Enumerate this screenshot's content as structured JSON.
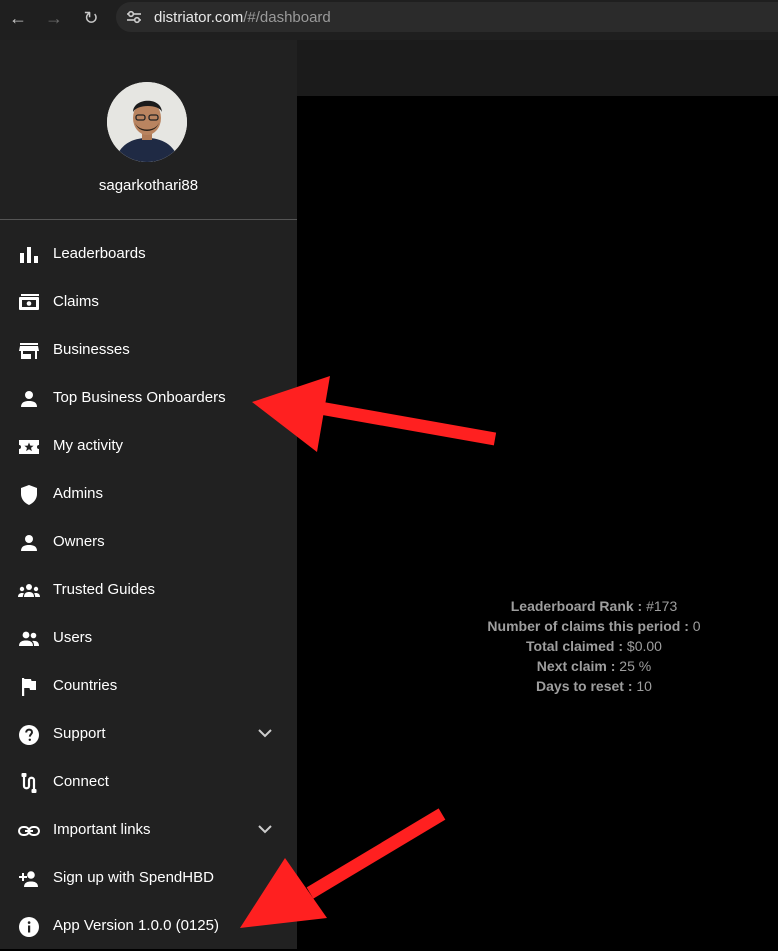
{
  "browser": {
    "url_host": "distriator.com",
    "url_path": "/#/dashboard"
  },
  "sidebar": {
    "username": "sagarkothari88",
    "items": [
      {
        "label": "Leaderboards",
        "icon": "leaderboard-icon"
      },
      {
        "label": "Claims",
        "icon": "receipt-icon"
      },
      {
        "label": "Businesses",
        "icon": "store-icon"
      },
      {
        "label": "Top Business Onboarders",
        "icon": "person-icon"
      },
      {
        "label": "My activity",
        "icon": "star-ticket-icon"
      },
      {
        "label": "Admins",
        "icon": "shield-icon"
      },
      {
        "label": "Owners",
        "icon": "person-icon"
      },
      {
        "label": "Trusted Guides",
        "icon": "groups-icon"
      },
      {
        "label": "Users",
        "icon": "people-icon"
      },
      {
        "label": "Countries",
        "icon": "flag-icon"
      },
      {
        "label": "Support",
        "icon": "help-icon"
      },
      {
        "label": "Connect",
        "icon": "connect-icon"
      },
      {
        "label": "Important links",
        "icon": "link-icon"
      },
      {
        "label": "Sign up with SpendHBD",
        "icon": "person-add-icon"
      },
      {
        "label": "App Version 1.0.0 (0125)",
        "icon": "info-icon"
      }
    ]
  },
  "stats": [
    {
      "label": "Leaderboard Rank :",
      "value": " #173"
    },
    {
      "label": "Number of claims this period :",
      "value": " 0"
    },
    {
      "label": "Total claimed :",
      "value": " $0.00"
    },
    {
      "label": "Next claim :",
      "value": " 25 %"
    },
    {
      "label": "Days to reset :",
      "value": " 10"
    }
  ],
  "colors": {
    "sidebar_bg": "#212121",
    "main_bg": "#000000",
    "annotation_arrow": "#ff2020"
  }
}
